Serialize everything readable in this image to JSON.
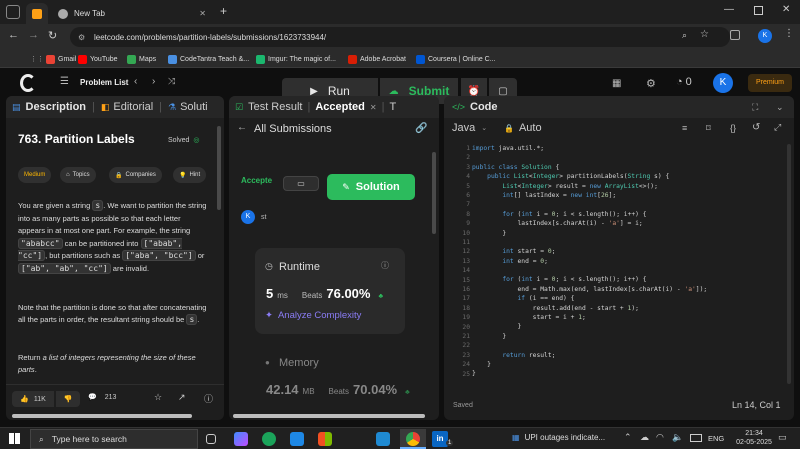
{
  "browser": {
    "tabs": [
      {
        "title": "",
        "active": true
      },
      {
        "title": "New Tab",
        "active": false
      }
    ],
    "url": "leetcode.com/problems/partition-labels/submissions/1623733944/",
    "profile_initial": "K",
    "bookmarks": [
      "Gmail",
      "YouTube",
      "Maps",
      "CodeTantra Teach &...",
      "Imgur: The magic of...",
      "Adobe Acrobat",
      "Coursera | Online C..."
    ]
  },
  "lc": {
    "problem_list": "Problem List",
    "run": "Run",
    "submit": "Submit",
    "coins": "0",
    "avatar": "K",
    "premium": "Premium"
  },
  "left_panel": {
    "tabs": [
      "Description",
      "Editorial",
      "Soluti"
    ],
    "title": "763. Partition Labels",
    "status": "Solved",
    "chips": [
      "Medium",
      "Topics",
      "Companies",
      "Hint"
    ],
    "p1_a": "You are given a string",
    "p1_s": "s",
    "p1_b": ". We want to partition the string into as many parts as possible so that each letter appears in at most one part. For example, the string",
    "ex1": "\"ababcc\"",
    "p1_c": "can be partitioned into",
    "ex2": "[\"abab\", \"cc\"]",
    "p1_d": ", but partitions such as",
    "ex3": "[\"aba\", \"bcc\"]",
    "p1_or": "or",
    "ex4": "[\"ab\", \"ab\", \"cc\"]",
    "p1_e": "are invalid.",
    "p2_a": "Note that the partition is done so that after concatenating all the parts in order, the resultant string should be",
    "p2_s": "s",
    "p2_b": ".",
    "p3_a": "Return",
    "p3_i": "a list of integers representing the size of these parts",
    "p3_b": ".",
    "likes": "11K",
    "comments": "213"
  },
  "mid_panel": {
    "tabs": [
      "Test Result",
      "Accepted",
      "T"
    ],
    "header": "All Submissions",
    "accepted": "Accepte",
    "solution_btn": "Solution",
    "user_initial": "K",
    "user_name": "st",
    "runtime_title": "Runtime",
    "runtime_value": "5",
    "runtime_unit": "ms",
    "beats_label": "Beats",
    "runtime_beats": "76.00%",
    "analyze": "Analyze Complexity",
    "memory_title": "Memory",
    "memory_value": "42.14",
    "memory_unit": "MB",
    "memory_beats": "70.04%"
  },
  "code_panel": {
    "title": "Code",
    "language": "Java",
    "mode": "Auto",
    "status": "Saved",
    "cursor": "Ln 14, Col 1",
    "lines": [
      "import java.util.*;",
      "",
      "public class Solution {",
      "    public List<Integer> partitionLabels(String s) {",
      "        List<Integer> result = new ArrayList<>();",
      "        int[] lastIndex = new int[26];",
      "",
      "        for (int i = 0; i < s.length(); i++) {",
      "            lastIndex[s.charAt(i) - 'a'] = i;",
      "        }",
      "",
      "        int start = 0;",
      "        int end = 0;",
      "",
      "        for (int i = 0; i < s.length(); i++) {",
      "            end = Math.max(end, lastIndex[s.charAt(i) - 'a']);",
      "            if (i == end) {",
      "                result.add(end - start + 1);",
      "                start = i + 1;",
      "            }",
      "        }",
      "",
      "        return result;",
      "    }",
      "}"
    ]
  },
  "taskbar": {
    "search": "Type here to search",
    "news": "UPI outages indicate...",
    "lang": "ENG",
    "time": "21:34",
    "date": "02-05-2025",
    "notif": "1"
  },
  "colors": {
    "accent_green": "#2cbb5d",
    "orange": "#ffa116",
    "blue": "#1a73e8"
  }
}
